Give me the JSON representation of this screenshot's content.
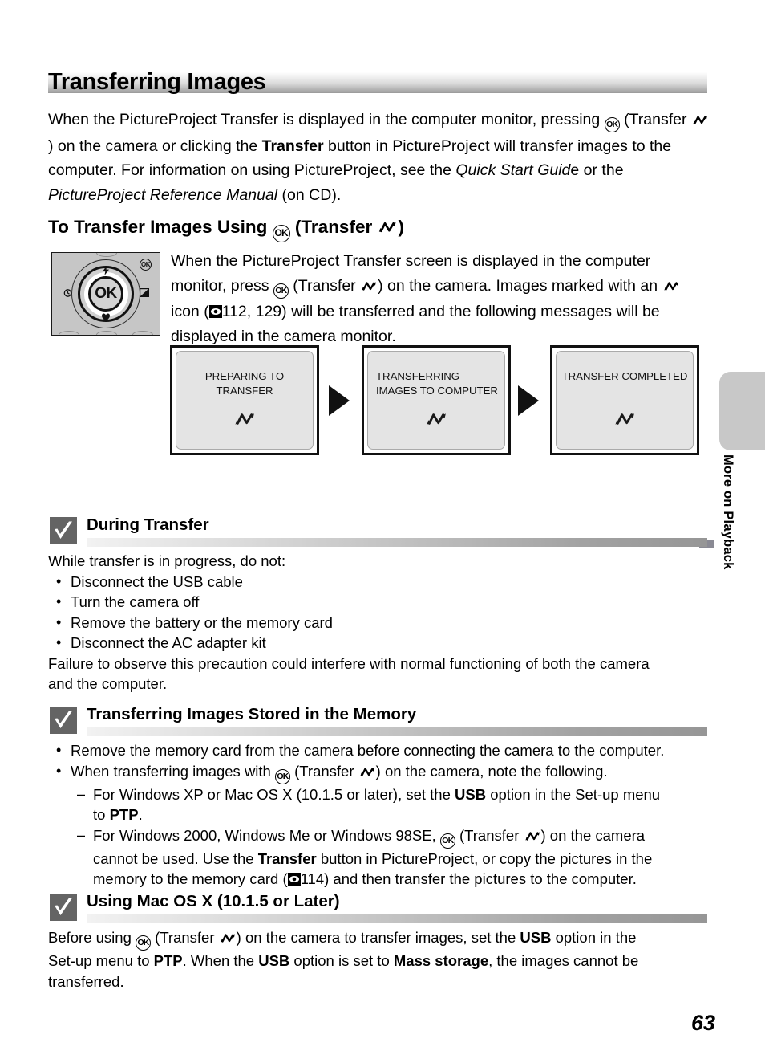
{
  "page": {
    "number": "63",
    "side_tab_label": "More on Playback",
    "title": "Transferring Images"
  },
  "intro": {
    "line1_a": "When the PictureProject Transfer is displayed in the computer monitor, pressing",
    "line2_a": " (Transfer ",
    "line2_b": ") on the camera or clicking the ",
    "line2_bold": "Transfer",
    "line2_c": " button in PictureProject",
    "line3": "will transfer images to the computer. For information on using PictureProject, see",
    "line4_a": "the ",
    "line4_i1": "Quick Start Guid",
    "line4_b": "e or the ",
    "line4_i2": "PictureProject Reference Manual",
    "line4_c": " (on CD)."
  },
  "h2": {
    "prefix": "To Transfer Images Using ",
    "mid": " (Transfer ",
    "suffix": ")"
  },
  "camera": {
    "ok_label": "OK",
    "ok_badge_label": "OK",
    "tick_up": "♣",
    "tick_down": "☙",
    "tick_left": "⌚",
    "tick_right": "⬚"
  },
  "cam_text": {
    "l1": "When the PictureProject Transfer screen is displayed in the computer",
    "l2_a": "monitor, press ",
    "l2_b": " (Transfer ",
    "l2_c": ") on the camera.",
    "l3_a": "Images marked with an ",
    "l3_b": " icon (",
    "l3_ref": "112, 129",
    "l3_c": ") will be transferred and",
    "l4": "the following messages will be displayed in the camera monitor."
  },
  "monitors": [
    {
      "message": "PREPARING TO TRANSFER",
      "icon": "transfer-icon"
    },
    {
      "message": "TRANSFERRING IMAGES TO COMPUTER",
      "icon": "transfer-icon"
    },
    {
      "message": "TRANSFER COMPLETED",
      "icon": "transfer-icon"
    }
  ],
  "notes": [
    {
      "title": "During Transfer",
      "intro": "While transfer is in progress, do not:",
      "bullets": [
        "Disconnect the USB cable",
        "Turn the camera off",
        "Remove the battery or the memory card",
        "Disconnect the AC adapter kit"
      ],
      "outro_l1": "Failure to observe this precaution could interfere with normal functioning of both the camera",
      "outro_l2": "and the computer."
    },
    {
      "title": "Transferring Images Stored in the Memory",
      "b1": "Remove the memory card from the camera before connecting the camera to the computer.",
      "b2_a": "When transferring images with ",
      "b2_b": " (Transfer ",
      "b2_c": ") on the camera, note the following.",
      "d1_a": "For Windows XP or Mac OS X (10.1.5 or later), set the ",
      "d1_usb": "USB",
      "d1_b": " option in the Set-up menu",
      "d1_c": "to ",
      "d1_ptp": "PTP",
      "d1_d": ".",
      "d2_a": "For Windows 2000, Windows Me or Windows 98SE, ",
      "d2_b": " (Transfer ",
      "d2_c": ") on the camera",
      "d2_d": "cannot be used. Use the ",
      "d2_transfer": "Transfer",
      "d2_e": " button in PictureProject, or copy the pictures in the",
      "d2_f": "memory to the memory card (",
      "d2_ref": "114",
      "d2_g": ") and then transfer the pictures to the computer."
    },
    {
      "title": "Using Mac OS X (10.1.5 or Later)",
      "p_a": "Before using ",
      "p_b": " (Transfer ",
      "p_c": ") on the camera to transfer images, set the ",
      "p_usb1": "USB",
      "p_d": " option in the",
      "p_e": "Set-up menu to ",
      "p_ptp": "PTP",
      "p_f": ". When the ",
      "p_usb2": "USB",
      "p_g": " option is set to ",
      "p_mass": "Mass storage",
      "p_h": ", the images cannot be",
      "p_i": "transferred."
    }
  ],
  "colors": {
    "tab_gray": "#c8c8c8",
    "check_gray": "#646464",
    "screen_gray": "#e4e4e4"
  }
}
